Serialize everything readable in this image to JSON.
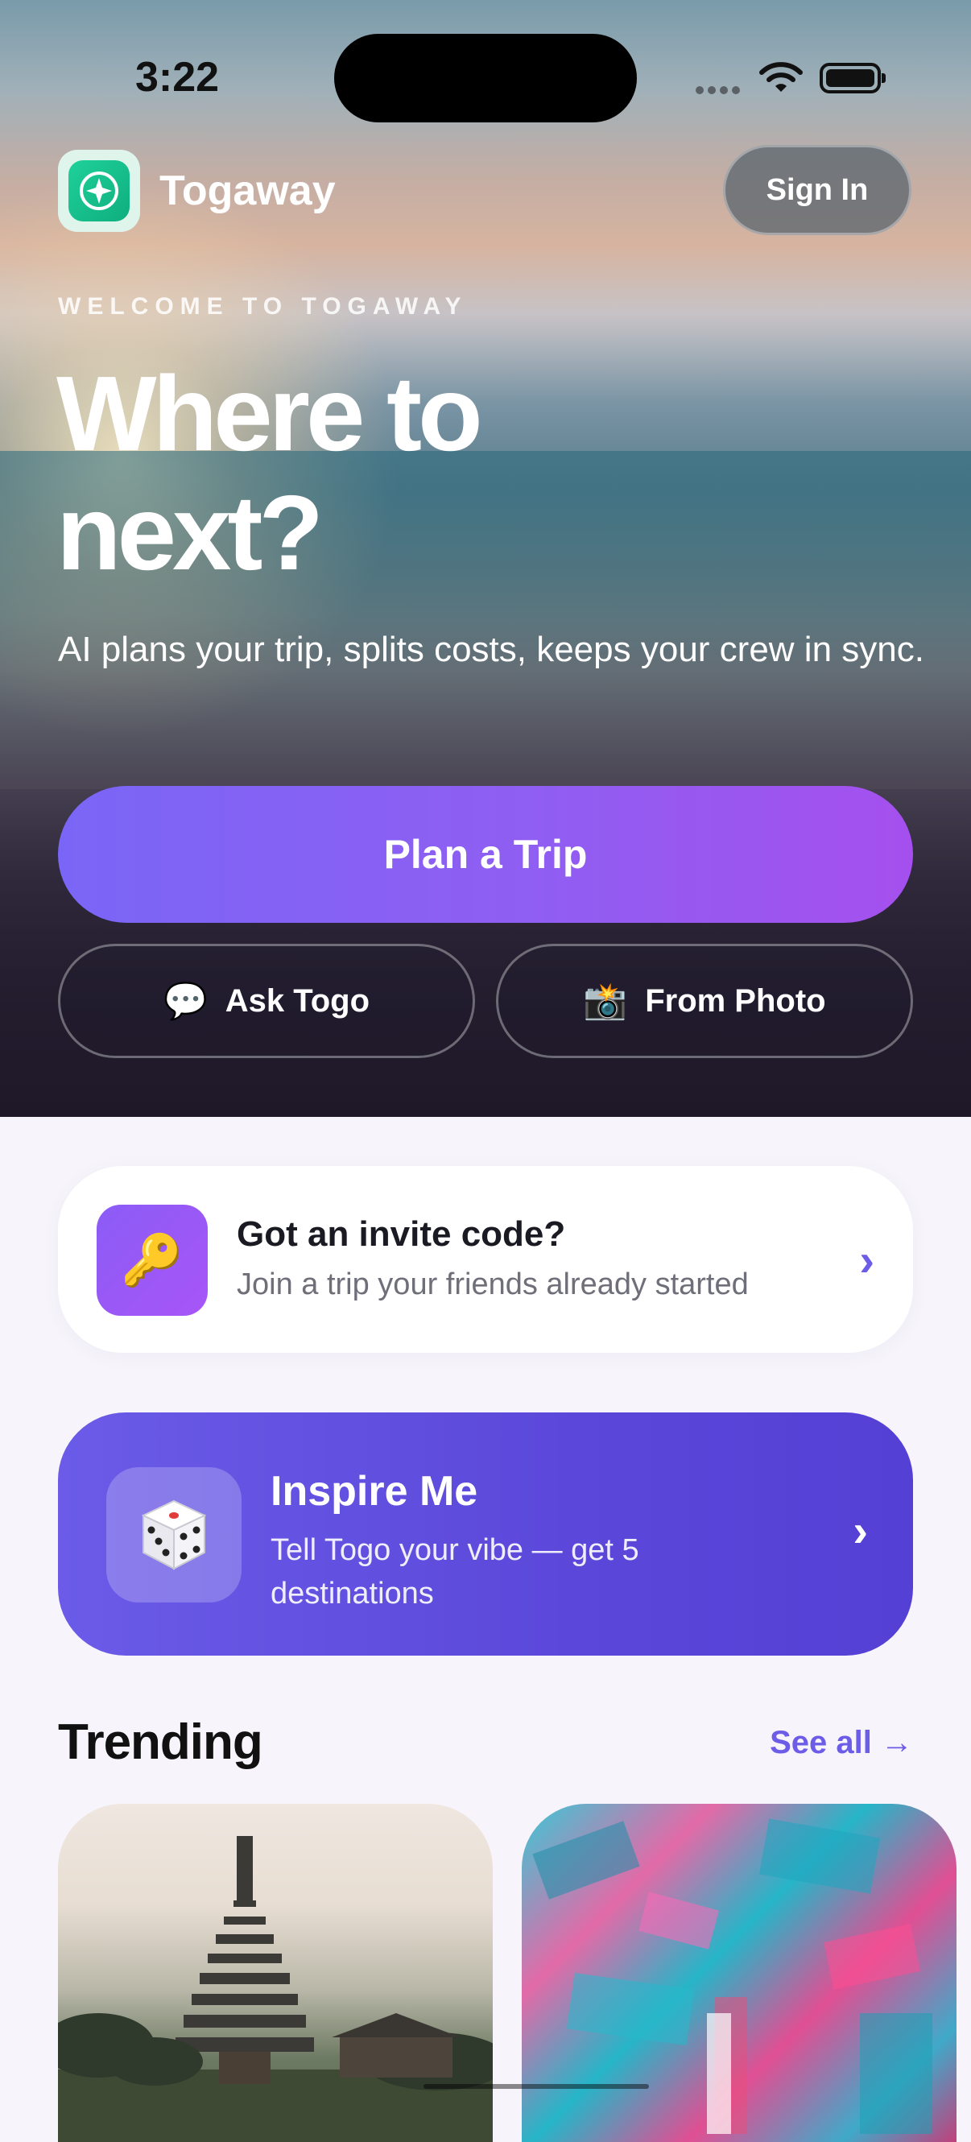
{
  "status": {
    "time": "3:22"
  },
  "brand": {
    "name": "Togaway",
    "sign_in": "Sign In"
  },
  "hero": {
    "kicker": "WELCOME TO TOGAWAY",
    "headline_1": "Where to",
    "headline_2": "next?",
    "subtitle": "AI plans your trip, splits costs, keeps your crew in sync.",
    "plan_button": "Plan a Trip",
    "ask_button": "Ask Togo",
    "ask_icon": "💬",
    "photo_button": "From Photo",
    "photo_icon": "📸"
  },
  "invite": {
    "icon": "🔑",
    "title": "Got an invite code?",
    "subtitle": "Join a trip your friends already started",
    "chevron": "›"
  },
  "inspire": {
    "title": "Inspire Me",
    "subtitle": "Tell Togo your vibe — get 5 destinations",
    "chevron": "›"
  },
  "trending": {
    "title": "Trending",
    "see_all": "See all →"
  },
  "colors": {
    "accent": "#6c5ce7",
    "plan_gradient_start": "#7a66f6",
    "plan_gradient_end": "#a550ee",
    "brand_green": "#1fd19a"
  }
}
